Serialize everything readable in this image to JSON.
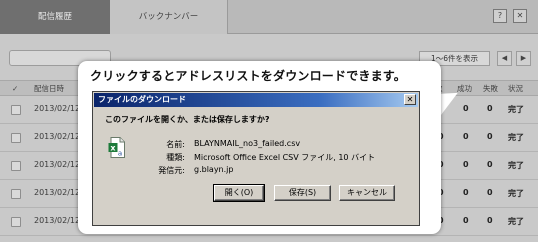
{
  "tabs": [
    {
      "label": "配信履歴",
      "active": true
    },
    {
      "label": "バックナンバー",
      "active": false
    }
  ],
  "top_icons": [
    "?",
    "✕"
  ],
  "pager": {
    "text": "1〜6件を表示",
    "prev": "◀",
    "next": "▶"
  },
  "table": {
    "headers": {
      "check": "✓",
      "date": "配信日時",
      "count": "数",
      "success": "成功",
      "fail": "失敗",
      "status": "状況"
    },
    "rows": [
      {
        "date": "2013/02/12",
        "count": "0",
        "success": "0",
        "fail": "0",
        "status": "完了"
      },
      {
        "date": "2013/02/12",
        "count": "0",
        "success": "0",
        "fail": "0",
        "status": "完了"
      },
      {
        "date": "2013/02/12",
        "count": "0",
        "success": "0",
        "fail": "0",
        "status": "完了"
      },
      {
        "date": "2013/02/12",
        "count": "0",
        "success": "0",
        "fail": "0",
        "status": "完了"
      },
      {
        "date": "2013/02/12",
        "count": "0",
        "success": "0",
        "fail": "0",
        "status": "完了"
      }
    ]
  },
  "callout": {
    "text": "クリックするとアドレスリストをダウンロードできます。"
  },
  "dialog": {
    "title": "ファイルのダウンロード",
    "close": "✕",
    "question": "このファイルを開くか、または保存しますか?",
    "name_label": "名前:",
    "name_value": "BLAYNMAIL_no3_failed.csv",
    "type_label": "種類:",
    "type_value": "Microsoft Office Excel CSV ファイル, 10 バイト",
    "from_label": "発信元:",
    "from_value": "g.blayn.jp",
    "buttons": {
      "open": "開く(O)",
      "save": "保存(S)",
      "cancel": "キャンセル"
    },
    "icon": "excel-csv-file-icon"
  }
}
